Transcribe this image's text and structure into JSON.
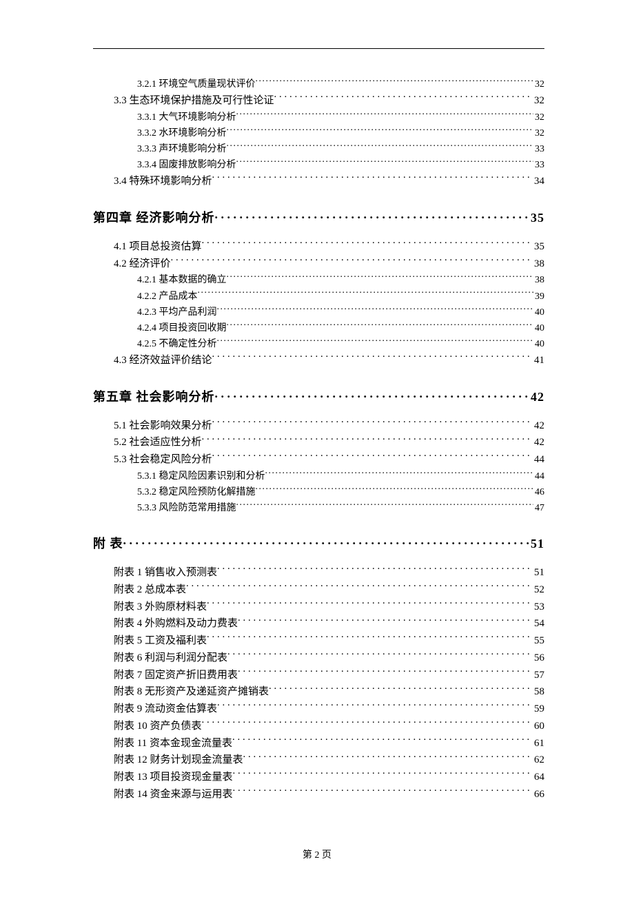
{
  "footer": "第 2 页",
  "entries": [
    {
      "level": "sub",
      "label": "3.2.1 环境空气质量现状评价",
      "page": "32"
    },
    {
      "level": "section",
      "label": "3.3 生态环境保护措施及可行性论证",
      "page": "32"
    },
    {
      "level": "sub",
      "label": "3.3.1 大气环境影响分析",
      "page": "32"
    },
    {
      "level": "sub",
      "label": "3.3.2 水环境影响分析",
      "page": "32"
    },
    {
      "level": "sub",
      "label": "3.3.3 声环境影响分析",
      "page": "33"
    },
    {
      "level": "sub",
      "label": "3.3.4 固废排放影响分析",
      "page": "33"
    },
    {
      "level": "section",
      "label": "3.4 特殊环境影响分析",
      "page": "34"
    },
    {
      "level": "chapter",
      "label": "第四章 经济影响分析",
      "page": "35"
    },
    {
      "level": "section",
      "label": "4.1 项目总投资估算",
      "page": "35"
    },
    {
      "level": "section",
      "label": "4.2 经济评价",
      "page": "38"
    },
    {
      "level": "sub",
      "label": "4.2.1 基本数据的确立",
      "page": "38"
    },
    {
      "level": "sub",
      "label": "4.2.2 产品成本",
      "page": "39"
    },
    {
      "level": "sub",
      "label": "4.2.3 平均产品利润",
      "page": "40"
    },
    {
      "level": "sub",
      "label": "4.2.4 项目投资回收期",
      "page": "40"
    },
    {
      "level": "sub",
      "label": "4.2.5 不确定性分析",
      "page": "40"
    },
    {
      "level": "section",
      "label": "4.3 经济效益评价结论",
      "page": "41"
    },
    {
      "level": "chapter",
      "label": "第五章 社会影响分析",
      "page": "42"
    },
    {
      "level": "section",
      "label": "5.1 社会影响效果分析",
      "page": "42"
    },
    {
      "level": "section",
      "label": "5.2 社会适应性分析",
      "page": "42"
    },
    {
      "level": "section",
      "label": "5.3 社会稳定风险分析",
      "page": "44"
    },
    {
      "level": "sub",
      "label": "5.3.1 稳定风险因素识别和分析",
      "page": "44"
    },
    {
      "level": "sub",
      "label": "5.3.2 稳定风险预防化解措施",
      "page": "46"
    },
    {
      "level": "sub",
      "label": "5.3.3 风险防范常用措施",
      "page": "47"
    },
    {
      "level": "chapter",
      "label": "附 表",
      "page": "51"
    },
    {
      "level": "section",
      "label": "附表 1 销售收入预测表",
      "page": "51"
    },
    {
      "level": "section",
      "label": "附表 2 总成本表",
      "page": "52"
    },
    {
      "level": "section",
      "label": "附表 3 外购原材料表",
      "page": "53"
    },
    {
      "level": "section",
      "label": "附表 4 外购燃料及动力费表",
      "page": "54"
    },
    {
      "level": "section",
      "label": "附表 5 工资及福利表",
      "page": "55"
    },
    {
      "level": "section",
      "label": "附表 6 利润与利润分配表",
      "page": "56"
    },
    {
      "level": "section",
      "label": "附表 7 固定资产折旧费用表",
      "page": "57"
    },
    {
      "level": "section",
      "label": "附表 8 无形资产及递延资产摊销表",
      "page": "58"
    },
    {
      "level": "section",
      "label": "附表 9 流动资金估算表",
      "page": "59"
    },
    {
      "level": "section",
      "label": "附表 10 资产负债表",
      "page": "60"
    },
    {
      "level": "section",
      "label": "附表 11 资本金现金流量表",
      "page": "61"
    },
    {
      "level": "section",
      "label": "附表 12 财务计划现金流量表",
      "page": "62"
    },
    {
      "level": "section",
      "label": "附表 13 项目投资现金量表",
      "page": "64"
    },
    {
      "level": "section",
      "label": "附表 14 资金来源与运用表",
      "page": "66"
    }
  ]
}
